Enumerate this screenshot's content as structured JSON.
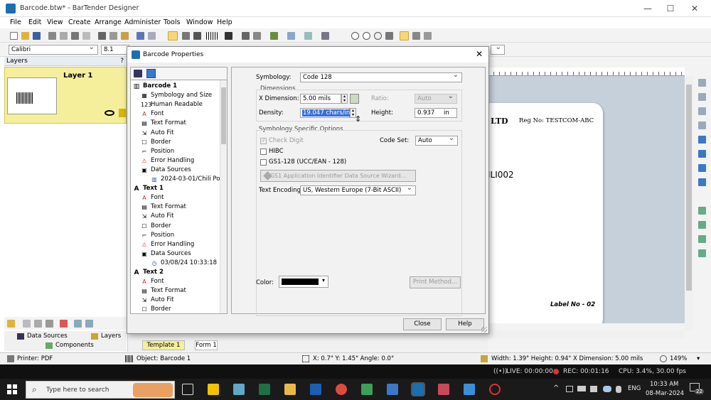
{
  "window": {
    "title": "Barcode.btw* - BarTender Designer",
    "min": "—",
    "max": "☐",
    "close": "✕"
  },
  "menu": [
    "File",
    "Edit",
    "View",
    "Create",
    "Arrange",
    "Administer",
    "Tools",
    "Window",
    "Help"
  ],
  "font_toolbar": {
    "font": "Calibri",
    "size": "8.1"
  },
  "layers": {
    "header": "Layers",
    "pin": "?",
    "layer_name": "Layer 1"
  },
  "bottom_tabs": {
    "data_sources": "Data Sources",
    "layers": "Layers",
    "components": "Components"
  },
  "doc_tabs": {
    "template": "Template 1",
    "form": "Form 1"
  },
  "label": {
    "company": "LTD",
    "reg": "Reg No: TESTCOM-ABC",
    "code": "ILI002",
    "label_no": "Label No - 02"
  },
  "dialog": {
    "title": "Barcode Properties",
    "close": "✕",
    "tree": [
      {
        "label": "Barcode 1",
        "icon": "barcode-icon",
        "level": 0,
        "bold": true
      },
      {
        "label": "Symbology and Size",
        "icon": "bars-icon",
        "level": 1
      },
      {
        "label": "Human Readable",
        "icon": "123-icon",
        "level": 1
      },
      {
        "label": "Font",
        "icon": "font-icon",
        "level": 1
      },
      {
        "label": "Text Format",
        "icon": "text-format-icon",
        "level": 1
      },
      {
        "label": "Auto Fit",
        "icon": "auto-fit-icon",
        "level": 1
      },
      {
        "label": "Border",
        "icon": "border-icon",
        "level": 1
      },
      {
        "label": "Position",
        "icon": "position-icon",
        "level": 1
      },
      {
        "label": "Error Handling",
        "icon": "error-icon",
        "level": 1
      },
      {
        "label": "Data Sources",
        "icon": "data-sources-icon",
        "level": 1
      },
      {
        "label": "2024-03-01/Chili Po",
        "icon": "datasource-item-icon",
        "level": 2
      },
      {
        "label": "Text 1",
        "icon": "text-icon",
        "level": 0,
        "bold": true
      },
      {
        "label": "Font",
        "icon": "font-icon",
        "level": 1
      },
      {
        "label": "Text Format",
        "icon": "text-format-icon",
        "level": 1
      },
      {
        "label": "Auto Fit",
        "icon": "auto-fit-icon",
        "level": 1
      },
      {
        "label": "Border",
        "icon": "border-icon",
        "level": 1
      },
      {
        "label": "Position",
        "icon": "position-icon",
        "level": 1
      },
      {
        "label": "Error Handling",
        "icon": "error-icon",
        "level": 1
      },
      {
        "label": "Data Sources",
        "icon": "data-sources-icon",
        "level": 1
      },
      {
        "label": "03/08/24 10:33:18",
        "icon": "clock-icon",
        "level": 2
      },
      {
        "label": "Text 2",
        "icon": "text-icon",
        "level": 0,
        "bold": true
      },
      {
        "label": "Font",
        "icon": "font-icon",
        "level": 1
      },
      {
        "label": "Text Format",
        "icon": "text-format-icon",
        "level": 1
      },
      {
        "label": "Auto Fit",
        "icon": "auto-fit-icon",
        "level": 1
      },
      {
        "label": "Border",
        "icon": "border-icon",
        "level": 1
      }
    ],
    "symbology_label": "Symbology:",
    "symbology_value": "Code 128",
    "dimensions_group": "Dimensions",
    "xdim_label": "X Dimension:",
    "xdim_value": "5.00 mils",
    "ratio_label": "Ratio:",
    "ratio_value": "Auto",
    "density_label": "Density:",
    "density_value": "19.047 chars/in",
    "height_label": "Height:",
    "height_value": "0.937",
    "height_unit": "in",
    "options_group": "Symbology Specific Options",
    "check_digit": "Check Digit",
    "code_set_label": "Code Set:",
    "code_set_value": "Auto",
    "hibc": "HIBC",
    "gs1": "GS1-128 (UCC/EAN - 128)",
    "wizard": "GS1 Application Identifier Data Source Wizard...",
    "encoding_label": "Text Encoding:",
    "encoding_value": "US, Western Europe (7-Bit ASCII)",
    "color_label": "Color:",
    "print_method": "Print Method...",
    "close_btn": "Close",
    "help_btn": "Help"
  },
  "statusbar": {
    "printer": "Printer: PDF",
    "object": "Object: Barcode 1",
    "coords": "X: 0.7\"  Y: 1.45\"  Angle: 0.0°",
    "size": "Width: 1.39\"  Height: 0.94\"  X Dimension: 5.00 mils",
    "zoom": "149%"
  },
  "recording": {
    "live": "LIVE: 00:00:00",
    "rec": "REC: 00:01:16",
    "cpu": "CPU: 3.4%, 30.00 fps"
  },
  "taskbar": {
    "search_placeholder": "Type here to search",
    "lang": "ENG",
    "time": "10:33 AM",
    "date": "08-Mar-2024",
    "notif": "22"
  },
  "colors": {
    "accent": "#1a6fb3",
    "layer_bg": "#f5ef9c",
    "taskbar": "#1a1a1a"
  }
}
